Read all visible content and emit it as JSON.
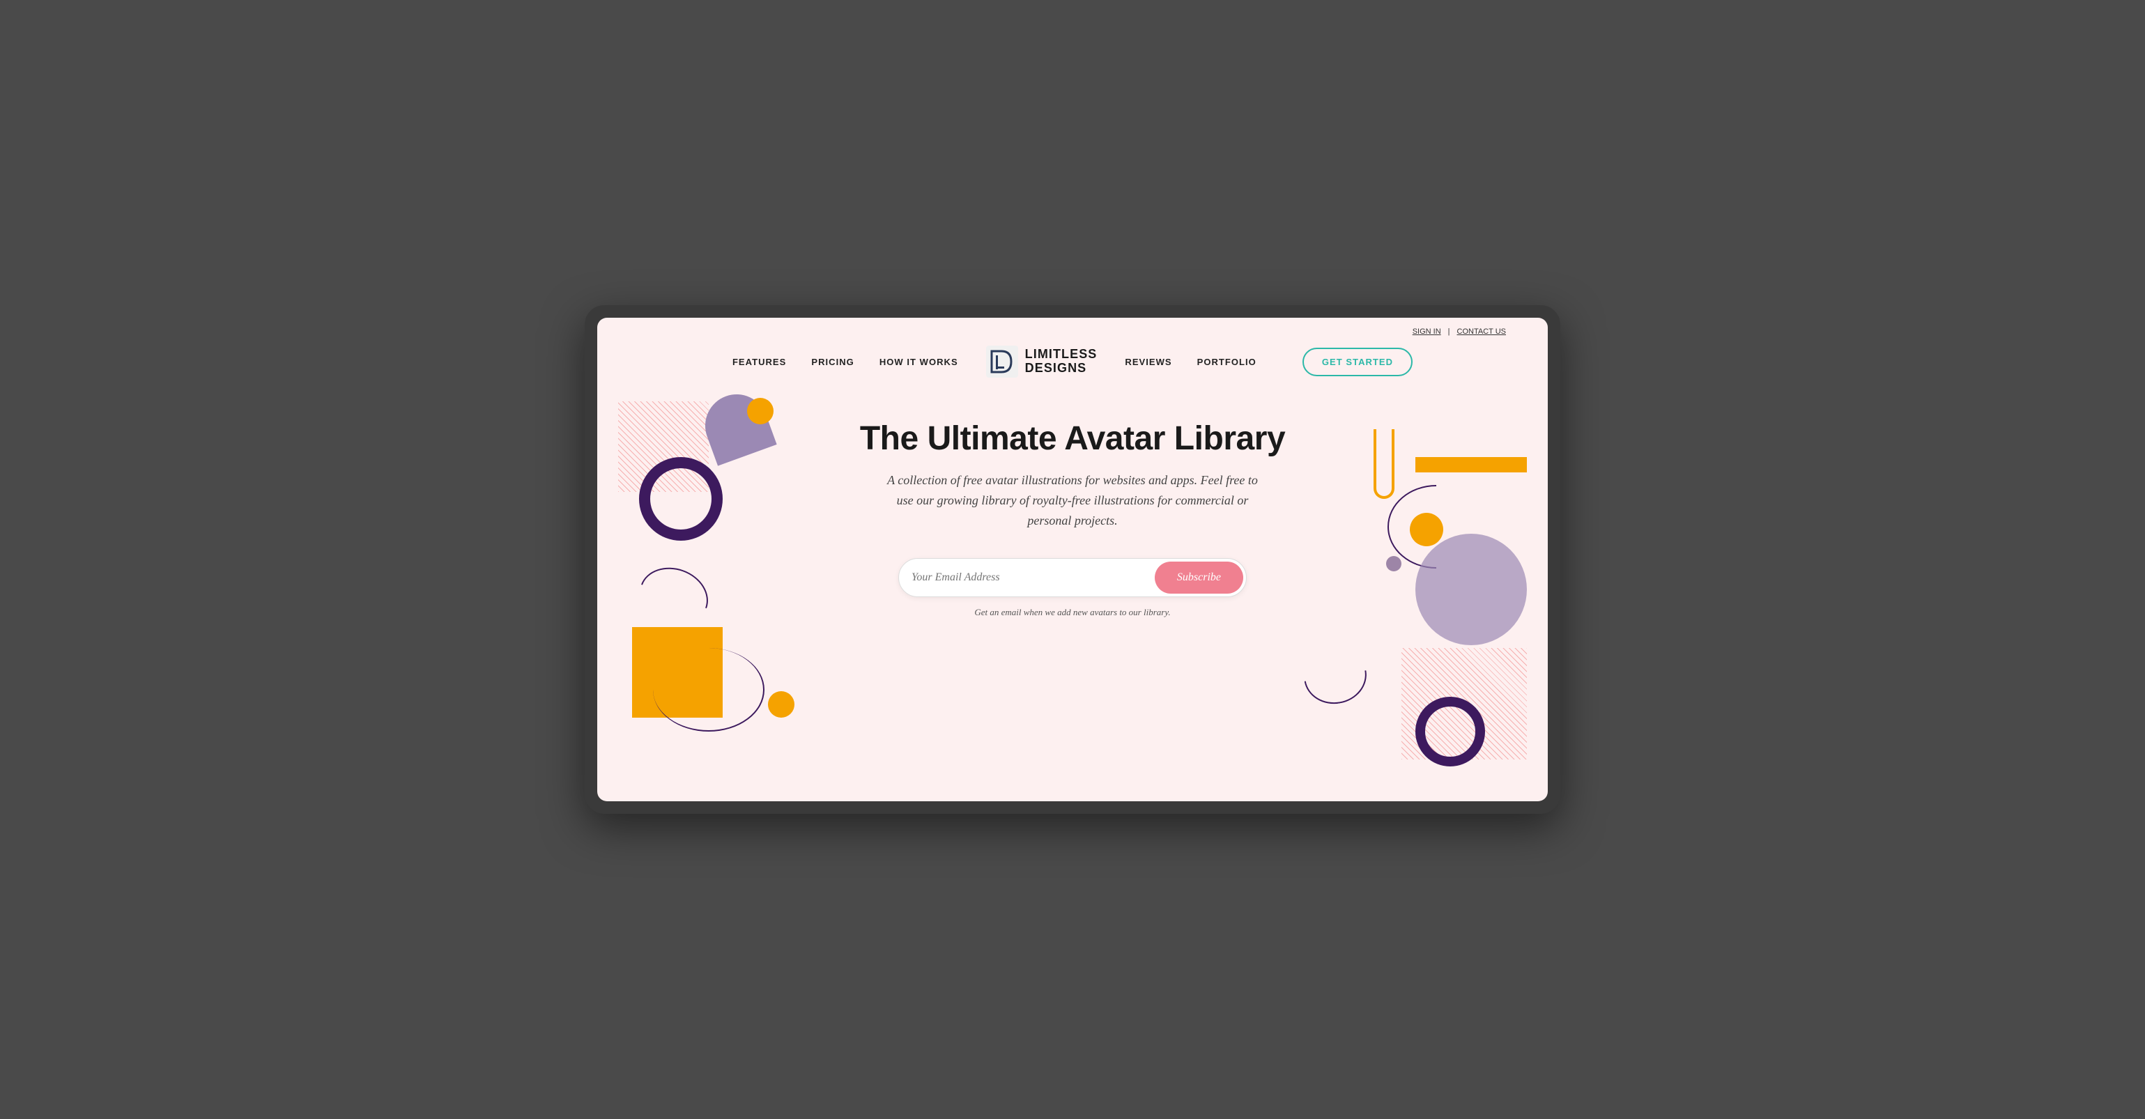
{
  "utility": {
    "signin_label": "SIGN IN",
    "separator": "|",
    "contact_label": "CONTACT US"
  },
  "nav": {
    "features_label": "FEATURES",
    "pricing_label": "PRICING",
    "how_it_works_label": "HOW IT WORKS",
    "reviews_label": "REVIEWS",
    "portfolio_label": "PORTFOLIO",
    "get_started_label": "GET STARTED",
    "logo_top": "LIMITLESS",
    "logo_bottom": "DESIGNS"
  },
  "hero": {
    "title": "The Ultimate Avatar Library",
    "subtitle": "A collection of free avatar illustrations for websites and apps. Feel free to use our growing library of royalty-free illustrations for commercial or personal projects.",
    "email_placeholder": "Your Email Address",
    "subscribe_label": "Subscribe",
    "hint": "Get an email when we add new avatars to our library."
  }
}
